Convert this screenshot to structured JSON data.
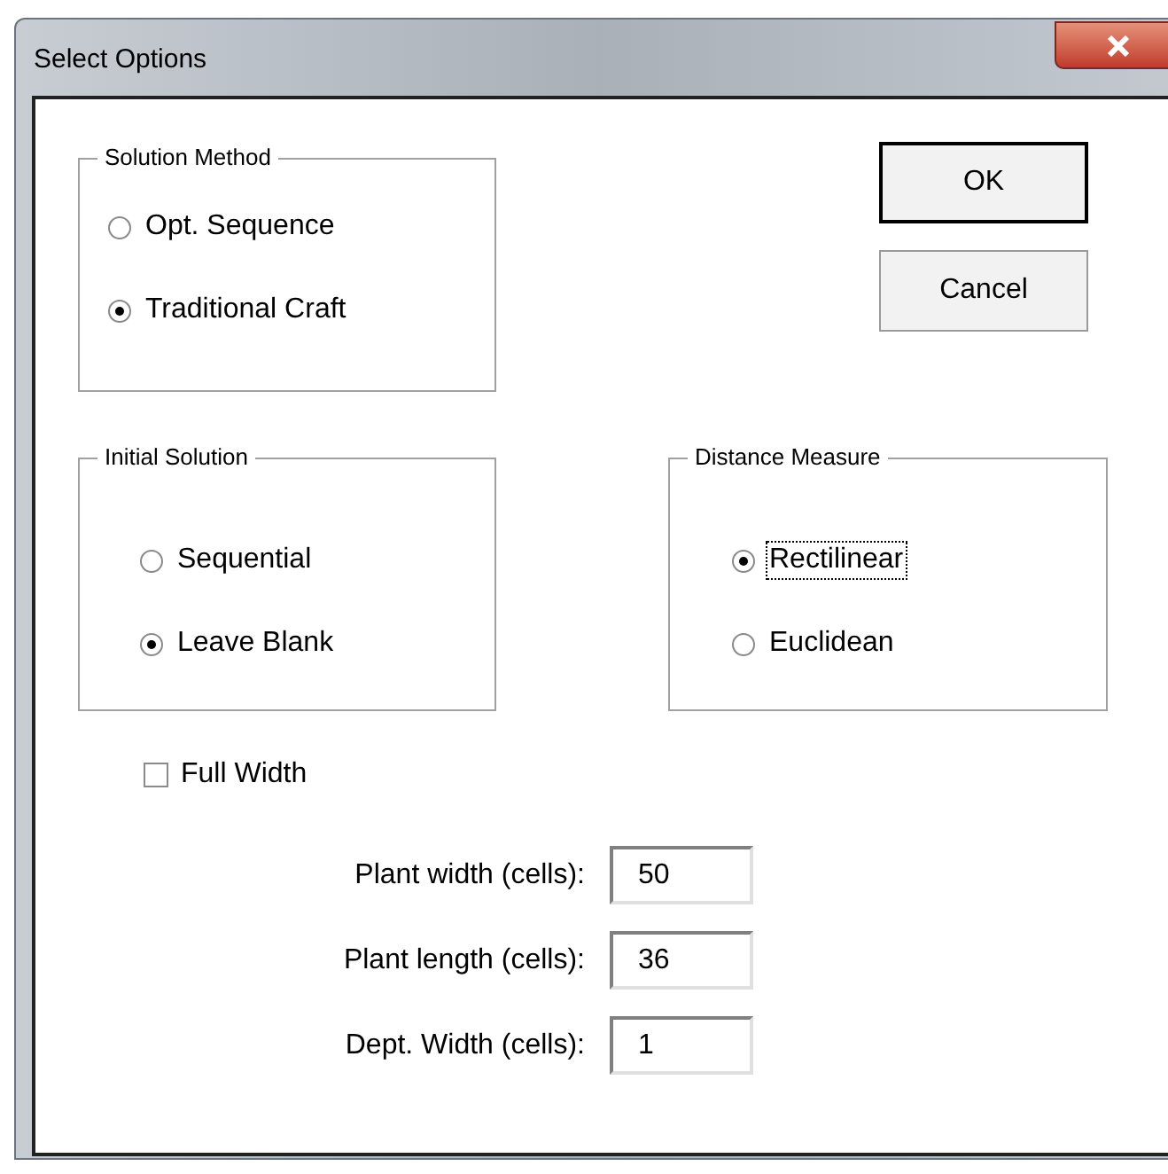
{
  "window": {
    "title": "Select Options"
  },
  "buttons": [
    {
      "label": "OK",
      "default": true
    },
    {
      "label": "Cancel",
      "default": false
    }
  ],
  "groups": [
    {
      "title": "Solution Method",
      "options": [
        {
          "label": "Opt. Sequence",
          "selected": false,
          "focused": false
        },
        {
          "label": "Traditional Craft",
          "selected": true,
          "focused": false
        }
      ]
    },
    {
      "title": "Initial Solution",
      "options": [
        {
          "label": "Sequential",
          "selected": false,
          "focused": false
        },
        {
          "label": "Leave Blank",
          "selected": true,
          "focused": false
        }
      ]
    },
    {
      "title": "Distance Measure",
      "options": [
        {
          "label": "Rectilinear",
          "selected": true,
          "focused": true
        },
        {
          "label": "Euclidean",
          "selected": false,
          "focused": false
        }
      ]
    }
  ],
  "checkbox": {
    "label": "Full Width",
    "checked": false
  },
  "fields": [
    {
      "label": "Plant width (cells):",
      "value": "50"
    },
    {
      "label": "Plant length (cells):",
      "value": "36"
    },
    {
      "label": "Dept. Width (cells):",
      "value": "1"
    }
  ]
}
